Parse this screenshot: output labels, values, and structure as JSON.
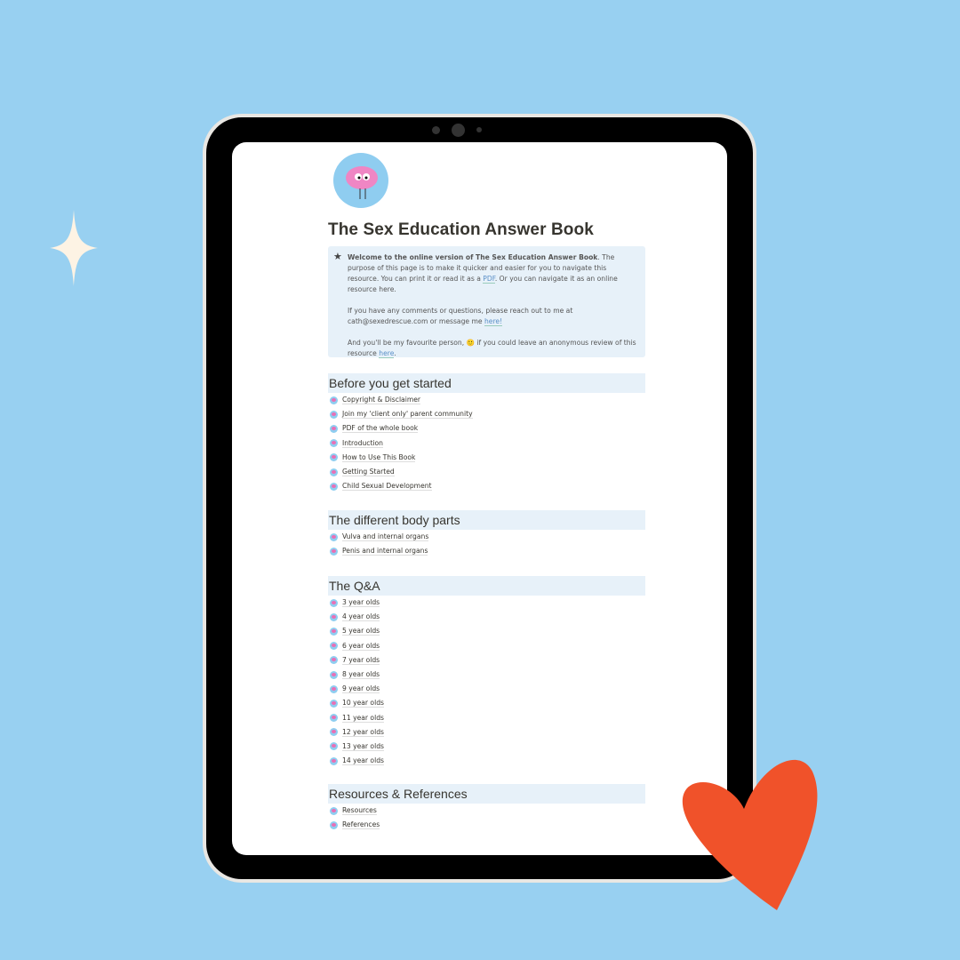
{
  "page": {
    "title": "The Sex Education Answer Book"
  },
  "callout": {
    "p1_bold": "Welcome to the online version of The Sex Education Answer Book",
    "p1_a": ". The purpose of this page is to make it quicker and easier for you to navigate this resource. You can print it or read it as a ",
    "p1_link": "PDF",
    "p1_b": ". Or you can navigate it as an online resource here.",
    "p2": "If you have any comments or questions, please reach out to me at cath@sexedrescue.com or message me ",
    "p2_link": "here!",
    "p3_a": "And you'll be my favourite person, ",
    "p3_emoji": "🙂",
    "p3_b": " if you could leave an anonymous review of this resource ",
    "p3_link": "here",
    "p3_end": "."
  },
  "sections": [
    {
      "heading": "Before you get started",
      "items": [
        "Copyright & Disclaimer",
        "Join my 'client only' parent community",
        "PDF of the whole book",
        "Introduction",
        "How to Use This Book",
        "Getting Started",
        "Child Sexual Development"
      ]
    },
    {
      "heading": "The different body parts",
      "items": [
        "Vulva and internal organs",
        "Penis and internal organs"
      ]
    },
    {
      "heading": "The Q&A",
      "items": [
        "3 year olds",
        "4 year olds",
        "5 year olds",
        "6 year olds",
        "7 year olds",
        "8 year olds",
        "9 year olds",
        "10 year olds",
        "11 year olds",
        "12 year olds",
        "13 year olds",
        "14 year olds"
      ]
    },
    {
      "heading": "Resources & References",
      "items": [
        "Resources",
        "References"
      ]
    }
  ],
  "colors": {
    "background": "#98d0f1",
    "heart": "#f0522a",
    "callout": "#e7f1f9"
  }
}
